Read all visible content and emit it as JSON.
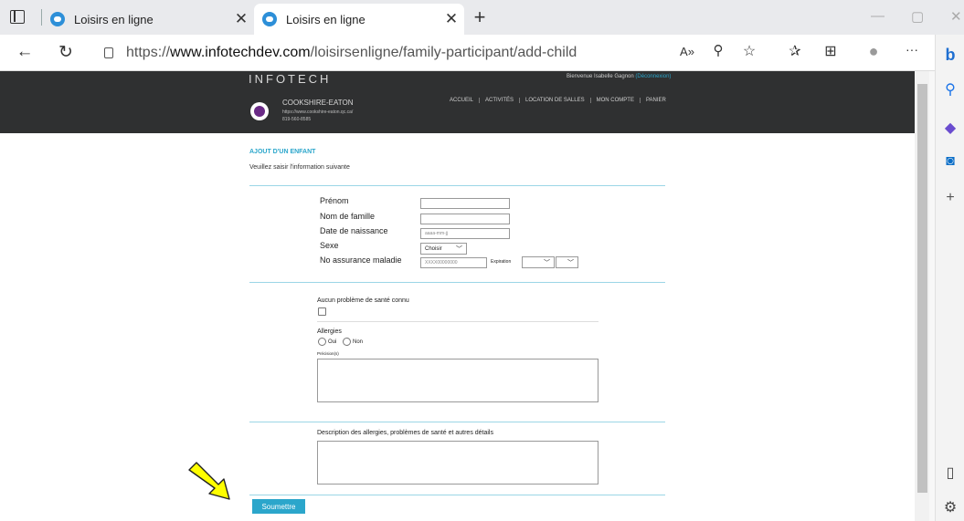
{
  "browser": {
    "tabs": [
      {
        "title": "Loisirs en ligne",
        "close": "✕"
      },
      {
        "title": "Loisirs en ligne",
        "close": "✕"
      }
    ],
    "new_tab": "+",
    "url_prefix": "https://",
    "url_host": "www.infotechdev.com",
    "url_path": "/loisirsenligne/family-participant/add-child",
    "colors": {
      "tab_active": "#ffffff",
      "tabstrip": "#e9eaed",
      "accent": "#2d8fd8"
    }
  },
  "site": {
    "logo": "INFOTECH",
    "welcome_prefix": "Bienvenue Isabelle Gagnon",
    "welcome_link": "(Déconnexion)",
    "org_name": "COOKSHIRE-EATON",
    "org_url": "https://www.cookshire-eaton.qc.ca/",
    "org_phone": "819-560-8585",
    "nav": [
      "ACCUEIL",
      "ACTIVITÉS",
      "LOCATION DE SALLES",
      "MON COMPTE",
      "PANIER"
    ],
    "colors": {
      "header_bg": "#2f3031",
      "accent": "#2ba6cb"
    }
  },
  "form": {
    "title": "AJOUT D'UN ENFANT",
    "subtitle": "Veuillez saisir l'information suivante",
    "fields": {
      "first_name": {
        "label": "Prénom",
        "value": ""
      },
      "last_name": {
        "label": "Nom de famille",
        "value": ""
      },
      "birthdate": {
        "label": "Date de naissance",
        "placeholder": "aaaa-mm-jj"
      },
      "sex": {
        "label": "Sexe",
        "selected": "Choisir"
      },
      "health_insurance": {
        "label": "No assurance maladie",
        "placeholder": "XXXX00000000",
        "expiration_label": "Expiration",
        "month": "",
        "year": ""
      }
    },
    "health": {
      "no_known_problem_label": "Aucun problème de santé connu",
      "allergies_label": "Allergies",
      "yes": "Oui",
      "no": "Non",
      "precisions_label": "Précision(s)",
      "description_label": "Description des allergies, problèmes de santé et autres détails"
    },
    "submit_label": "Soumettre"
  },
  "annotation": {
    "icon": "arrow-pointer-icon",
    "color": "#ffff00"
  }
}
